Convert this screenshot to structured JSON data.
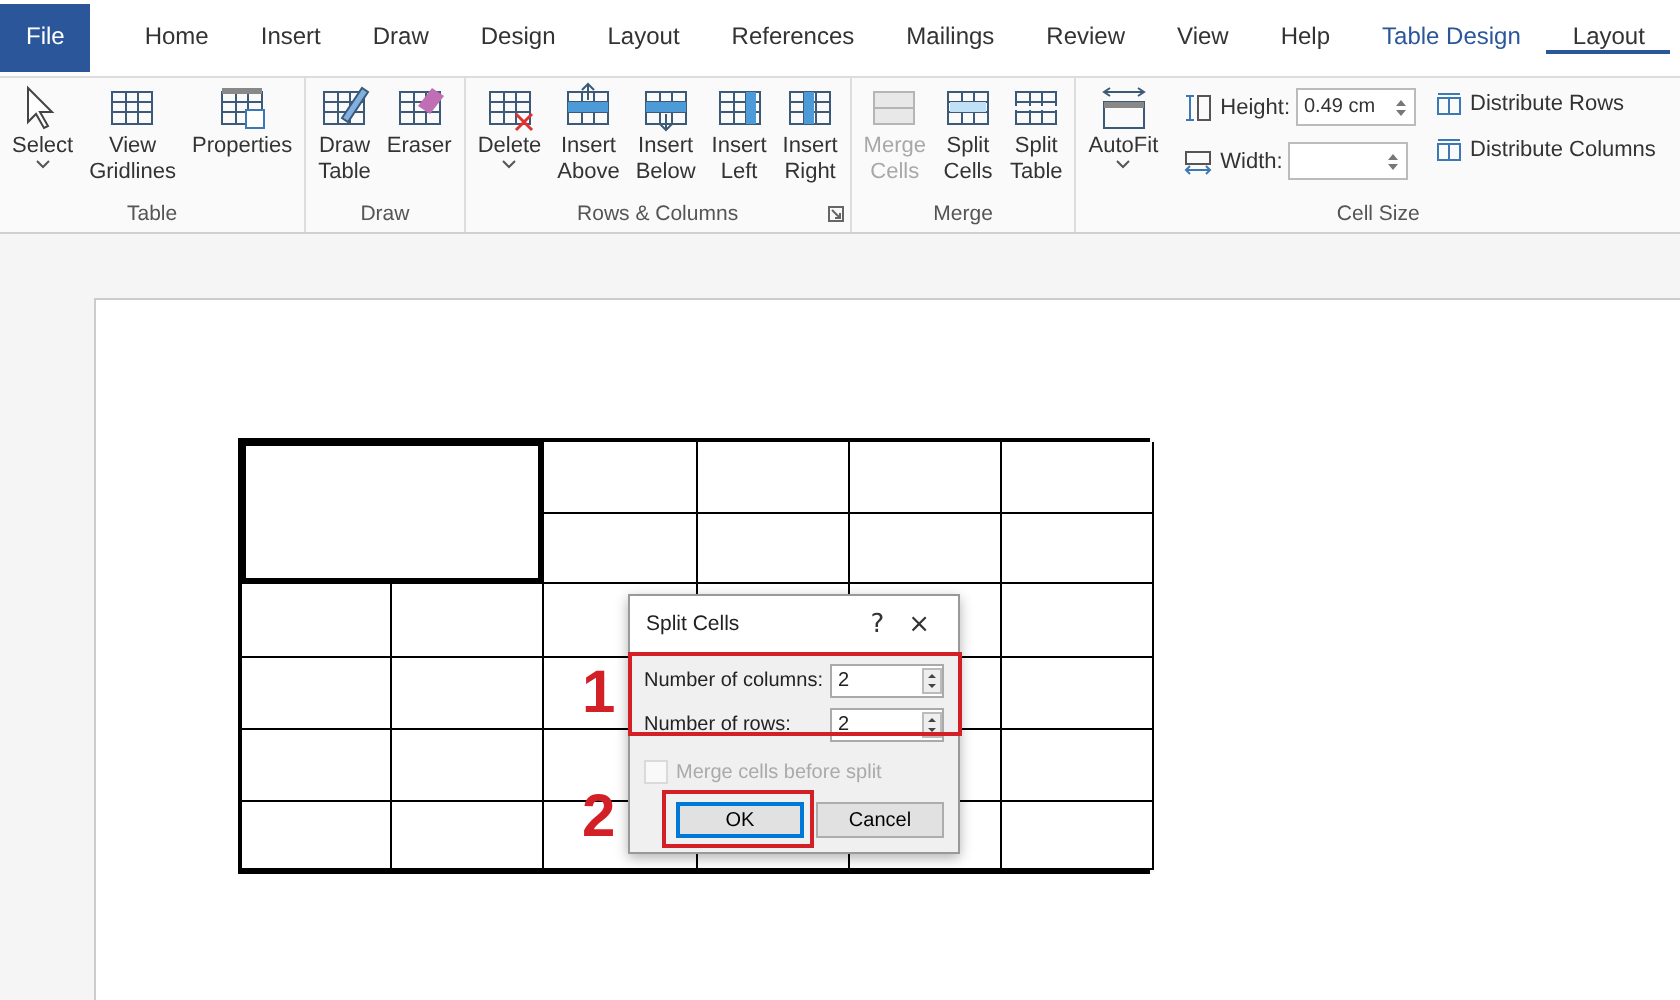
{
  "tabs": [
    {
      "label": "File",
      "kind": "file",
      "selected": false
    },
    {
      "label": "Home",
      "kind": "normal",
      "selected": false
    },
    {
      "label": "Insert",
      "kind": "normal",
      "selected": false
    },
    {
      "label": "Draw",
      "kind": "normal",
      "selected": false
    },
    {
      "label": "Design",
      "kind": "normal",
      "selected": false
    },
    {
      "label": "Layout",
      "kind": "normal",
      "selected": false
    },
    {
      "label": "References",
      "kind": "normal",
      "selected": false
    },
    {
      "label": "Mailings",
      "kind": "normal",
      "selected": false
    },
    {
      "label": "Review",
      "kind": "normal",
      "selected": false
    },
    {
      "label": "View",
      "kind": "normal",
      "selected": false
    },
    {
      "label": "Help",
      "kind": "normal",
      "selected": false
    },
    {
      "label": "Table Design",
      "kind": "contextual",
      "selected": false
    },
    {
      "label": "Layout",
      "kind": "contextual",
      "selected": true
    }
  ],
  "groups": [
    {
      "name": "Table",
      "launcher": false,
      "buttons": [
        {
          "label": "Select",
          "kind": "select",
          "disabled": false,
          "dropdown": true
        },
        {
          "label": "View Gridlines",
          "kind": "gridlines",
          "disabled": false,
          "dropdown": false
        },
        {
          "label": "Properties",
          "kind": "properties",
          "disabled": false,
          "dropdown": false
        }
      ]
    },
    {
      "name": "Draw",
      "launcher": false,
      "buttons": [
        {
          "label": "Draw Table",
          "kind": "draw",
          "disabled": false,
          "dropdown": false
        },
        {
          "label": "Eraser",
          "kind": "eraser",
          "disabled": false,
          "dropdown": false
        }
      ]
    },
    {
      "name": "Rows & Columns",
      "launcher": true,
      "buttons": [
        {
          "label": "Delete",
          "kind": "delete",
          "disabled": false,
          "dropdown": true
        },
        {
          "label": "Insert Above",
          "kind": "above",
          "disabled": false,
          "dropdown": false
        },
        {
          "label": "Insert Below",
          "kind": "below",
          "disabled": false,
          "dropdown": false
        },
        {
          "label": "Insert Left",
          "kind": "left",
          "disabled": false,
          "dropdown": false
        },
        {
          "label": "Insert Right",
          "kind": "right",
          "disabled": false,
          "dropdown": false
        }
      ]
    },
    {
      "name": "Merge",
      "launcher": false,
      "buttons": [
        {
          "label": "Merge Cells",
          "kind": "merge",
          "disabled": true,
          "dropdown": false
        },
        {
          "label": "Split Cells",
          "kind": "split",
          "disabled": false,
          "dropdown": false
        },
        {
          "label": "Split Table",
          "kind": "splittable",
          "disabled": false,
          "dropdown": false
        }
      ]
    }
  ],
  "cell_size": {
    "name": "Cell Size",
    "autofit": {
      "label": "AutoFit",
      "dropdown": true
    },
    "height": {
      "label": "Height:",
      "value": "0.49 cm"
    },
    "width": {
      "label": "Width:"
    },
    "distribute": [
      "Distribute Rows",
      "Distribute Columns"
    ]
  },
  "document": {
    "table": {
      "selected_cell": true
    }
  },
  "dialog": {
    "title": "Split Cells",
    "help": "?",
    "close": "×",
    "fields": [
      {
        "label": "Number of columns:",
        "value": "2"
      },
      {
        "label": "Number of rows:",
        "value": "2"
      }
    ],
    "merge_option": {
      "label": "Merge cells before split",
      "checked": false,
      "disabled": true
    },
    "buttons": [
      {
        "label": "OK",
        "default": true
      },
      {
        "label": "Cancel",
        "default": false
      }
    ]
  },
  "annotations": [
    "1",
    "2"
  ]
}
